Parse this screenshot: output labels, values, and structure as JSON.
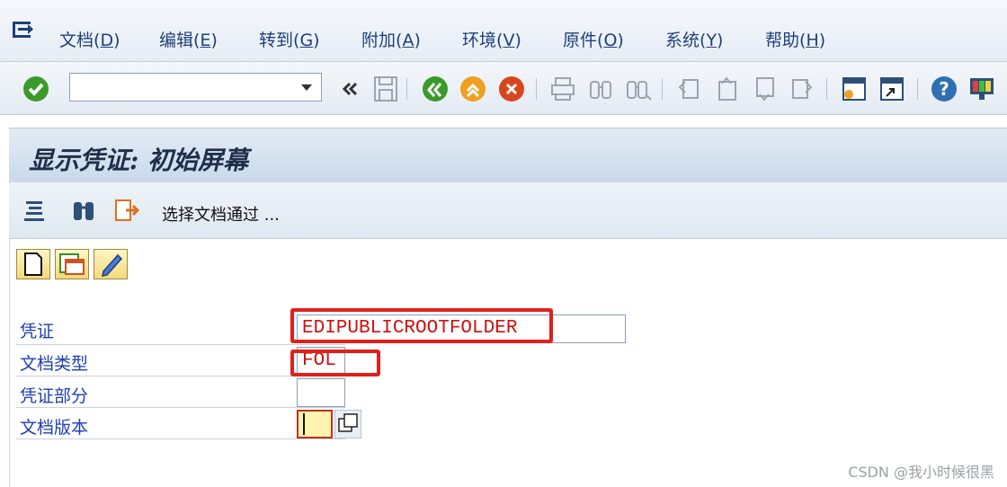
{
  "menu": {
    "items": [
      {
        "label": "文档",
        "key": "D"
      },
      {
        "label": "编辑",
        "key": "E"
      },
      {
        "label": "转到",
        "key": "G"
      },
      {
        "label": "附加",
        "key": "A"
      },
      {
        "label": "环境",
        "key": "V"
      },
      {
        "label": "原件",
        "key": "O"
      },
      {
        "label": "系统",
        "key": "Y"
      },
      {
        "label": "帮助",
        "key": "H"
      }
    ]
  },
  "toolbar": {
    "command_value": "",
    "icons": [
      "enter-icon",
      "back-double-icon",
      "save-icon",
      "back-icon",
      "exit-icon",
      "cancel-icon",
      "print-icon",
      "find-icon",
      "find-next-icon",
      "first-page-icon",
      "previous-page-icon",
      "next-page-icon",
      "last-page-icon",
      "create-session-icon",
      "shortcut-icon",
      "help-icon",
      "customize-layout-icon"
    ]
  },
  "screen": {
    "title": "显示凭证: 初始屏幕",
    "app_toolbar_label": "选择文档通过 ..."
  },
  "fields": {
    "document": {
      "label": "凭证",
      "value": "EDIPUBLICROOTFOLDER"
    },
    "doc_type": {
      "label": "文档类型",
      "value": "FOL"
    },
    "doc_part": {
      "label": "凭证部分",
      "value": ""
    },
    "doc_version": {
      "label": "文档版本",
      "value": ""
    }
  },
  "colors": {
    "highlight": "#e0201a",
    "label": "#1d3fb5",
    "value": "#d01010"
  },
  "watermark": "CSDN @我小时候很黑"
}
